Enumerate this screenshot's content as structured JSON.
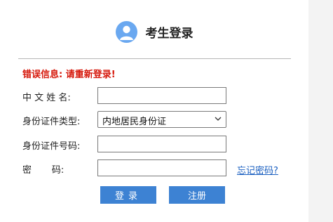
{
  "header": {
    "title": "考生登录"
  },
  "error_message": "错误信息: 请重新登录!",
  "form": {
    "name": {
      "label": "中 文 姓 名:",
      "value": ""
    },
    "id_type": {
      "label": "身份证件类型:",
      "selected": "内地居民身份证"
    },
    "id_number": {
      "label": "身份证件号码:",
      "value": ""
    },
    "password": {
      "label": "密       码:",
      "value": ""
    },
    "forgot_link": "忘记密码?"
  },
  "buttons": {
    "login": "登录",
    "register": "注册"
  },
  "colors": {
    "accent": "#3d82d3",
    "error": "#d6180b",
    "avatar": "#6aa8f0"
  },
  "icons": {
    "avatar": "user-avatar-icon",
    "select": "chevron-down-icon"
  }
}
